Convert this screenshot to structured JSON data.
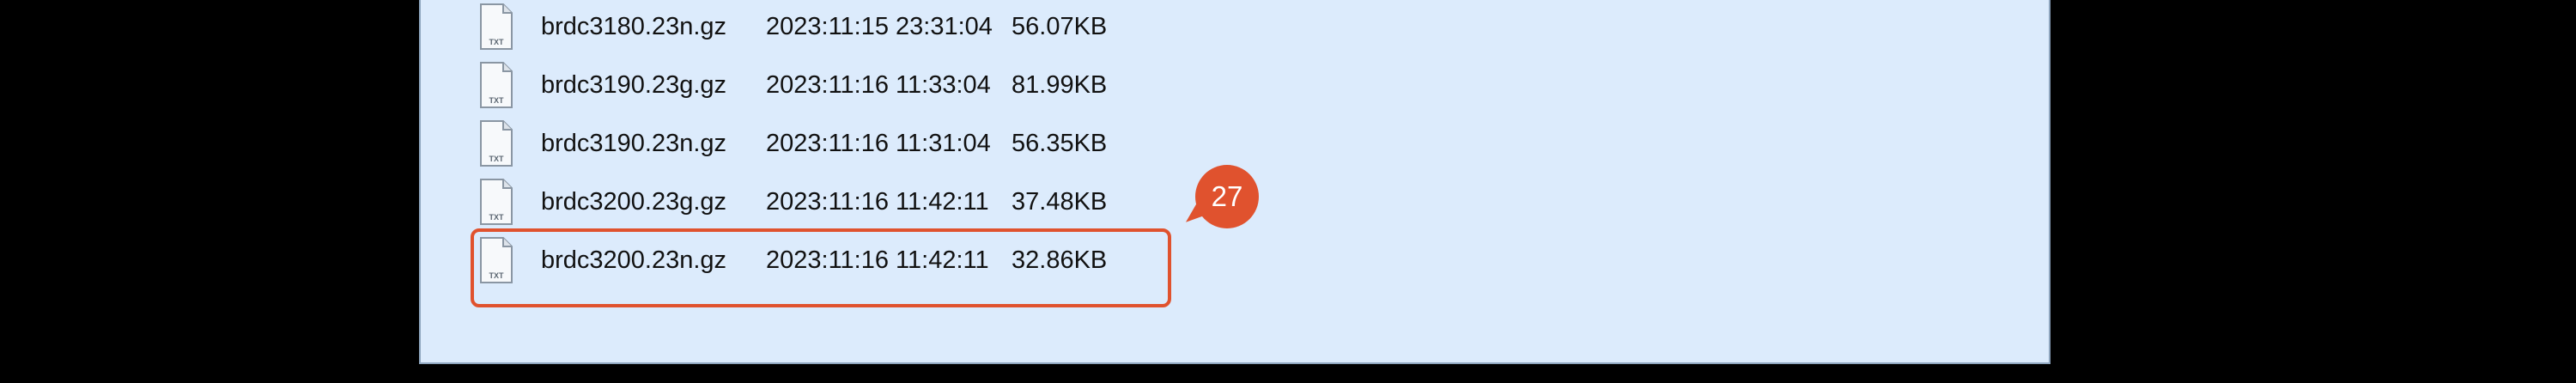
{
  "files": [
    {
      "name": "brdc3180.23n.gz",
      "date": "2023:11:15 23:31:04",
      "size": "56.07KB",
      "icon": "txt-file-icon",
      "icon_label": "TXT"
    },
    {
      "name": "brdc3190.23g.gz",
      "date": "2023:11:16 11:33:04",
      "size": "81.99KB",
      "icon": "txt-file-icon",
      "icon_label": "TXT"
    },
    {
      "name": "brdc3190.23n.gz",
      "date": "2023:11:16 11:31:04",
      "size": "56.35KB",
      "icon": "txt-file-icon",
      "icon_label": "TXT"
    },
    {
      "name": "brdc3200.23g.gz",
      "date": "2023:11:16 11:42:11",
      "size": "37.48KB",
      "icon": "txt-file-icon",
      "icon_label": "TXT"
    },
    {
      "name": "brdc3200.23n.gz",
      "date": "2023:11:16 11:42:11",
      "size": "32.86KB",
      "icon": "txt-file-icon",
      "icon_label": "TXT"
    }
  ],
  "annotation": {
    "badge": "27",
    "color": "#e0522e"
  },
  "colors": {
    "panel_bg": "#dcebfc",
    "frame_bg": "#000000"
  }
}
